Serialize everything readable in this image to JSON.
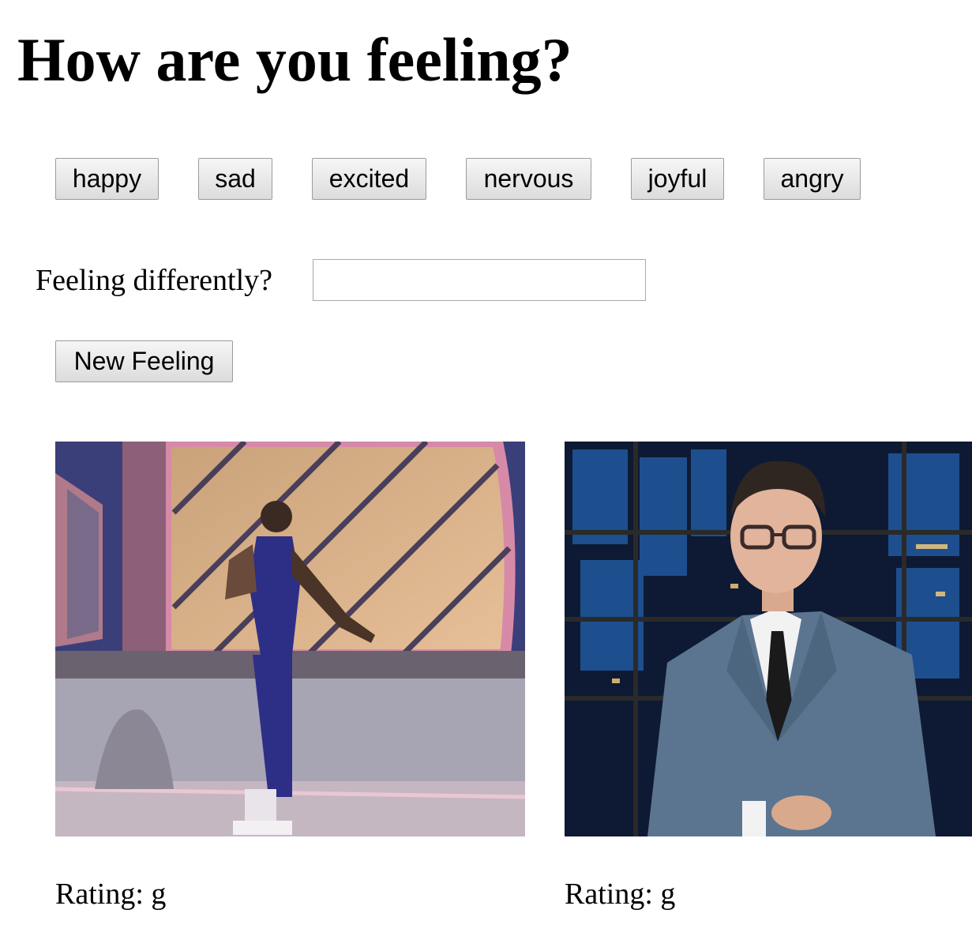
{
  "heading": "How are you feeling?",
  "feeling_buttons": [
    "happy",
    "sad",
    "excited",
    "nervous",
    "joyful",
    "angry"
  ],
  "custom_feeling": {
    "label": "Feeling differently?",
    "value": "",
    "placeholder": ""
  },
  "new_feeling_button": "New Feeling",
  "gifs": [
    {
      "rating_label": "Rating: g"
    },
    {
      "rating_label": "Rating: g"
    }
  ]
}
